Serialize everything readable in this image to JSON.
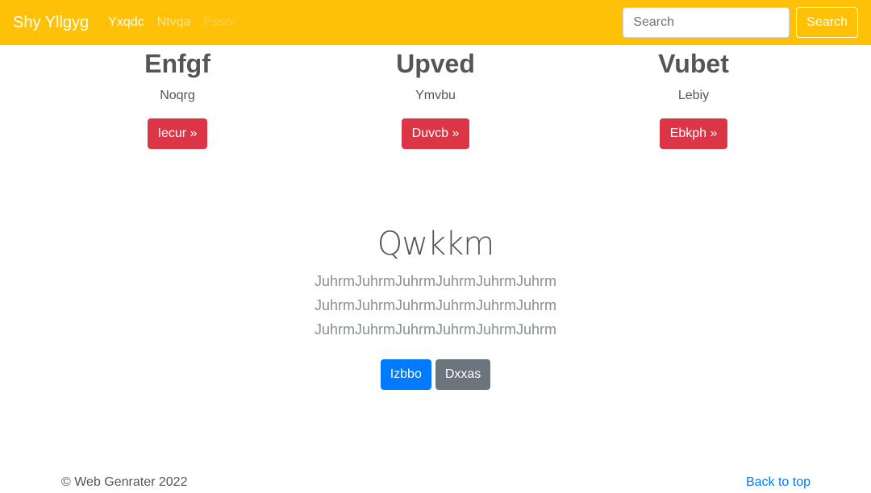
{
  "navbar": {
    "brand": "Shy Yllgyg",
    "links": [
      {
        "label": "Yxqdc",
        "state": "active"
      },
      {
        "label": "Ntvqa",
        "state": "normal"
      },
      {
        "label": "Pssoi",
        "state": "disabled"
      }
    ],
    "search_placeholder": "Search",
    "search_button": "Search",
    "background_color": "#ffc107"
  },
  "features": [
    {
      "title": "Enfgf",
      "text": "Noqrg",
      "button": "Iecur »"
    },
    {
      "title": "Upved",
      "text": "Ymvbu",
      "button": "Duvcb »"
    },
    {
      "title": "Vubet",
      "text": "Lebiy",
      "button": "Ebkph »"
    }
  ],
  "hero": {
    "title": "Qwkkm",
    "lines": [
      "JuhrmJuhrmJuhrmJuhrmJuhrmJuhrm",
      "JuhrmJuhrmJuhrmJuhrmJuhrmJuhrm",
      "JuhrmJuhrmJuhrmJuhrmJuhrmJuhrm"
    ],
    "primary_button": "Izbbo",
    "secondary_button": "Dxxas"
  },
  "footer": {
    "copyright": "© Web Genrater 2022",
    "back_to_top": "Back to top"
  },
  "colors": {
    "danger": "#dc3545",
    "primary": "#007bff",
    "secondary": "#6c757d"
  }
}
